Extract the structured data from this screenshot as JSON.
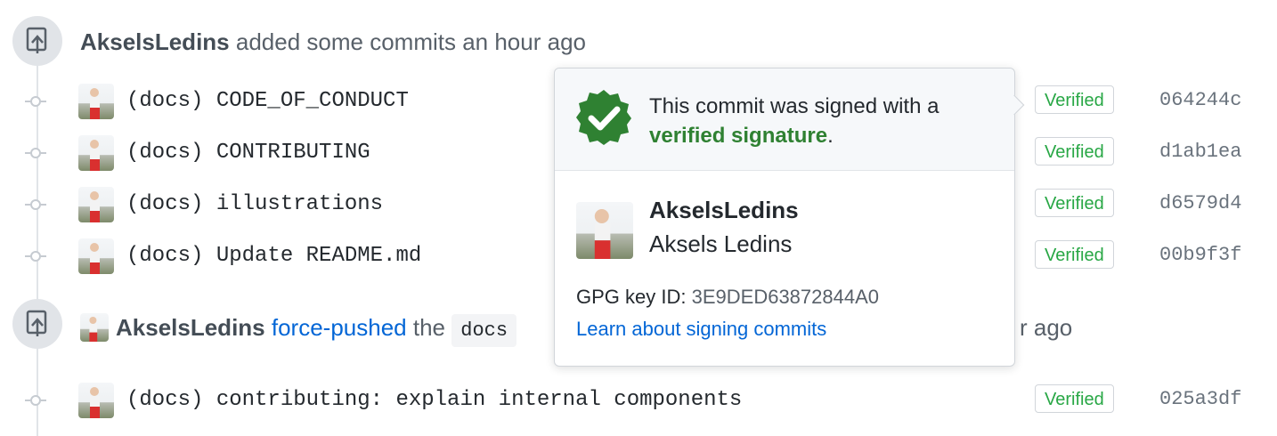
{
  "event1": {
    "author": "AkselsLedins",
    "action": "added some commits an hour ago"
  },
  "commits_group1": [
    {
      "message": "(docs) CODE_OF_CONDUCT",
      "badge": "Verified",
      "sha": "064244c"
    },
    {
      "message": "(docs) CONTRIBUTING",
      "badge": "Verified",
      "sha": "d1ab1ea"
    },
    {
      "message": "(docs) illustrations",
      "badge": "Verified",
      "sha": "d6579d4"
    },
    {
      "message": "(docs) Update README.md",
      "badge": "Verified",
      "sha": "00b9f3f"
    }
  ],
  "event2": {
    "author": "AkselsLedins",
    "link": "force-pushed",
    "the": "the",
    "branch": "docs",
    "tail": "r ago"
  },
  "commits_group2": [
    {
      "message": "(docs) contributing: explain internal components",
      "badge": "Verified",
      "sha": "025a3df"
    }
  ],
  "popover": {
    "signed_line1": "This commit was signed with a",
    "signed_strong": "verified signature",
    "signed_end": ".",
    "login": "AkselsLedins",
    "full_name": "Aksels Ledins",
    "gpg_label": "GPG key ID:",
    "gpg_key": "3E9DED63872844A0",
    "learn_link": "Learn about signing commits"
  },
  "colors": {
    "verified_green": "#28a745",
    "seal_green": "#2f8132",
    "link_blue": "#0366d6"
  },
  "icons": {
    "event_badge": "repo-push-icon",
    "seal": "verified-check-icon"
  }
}
